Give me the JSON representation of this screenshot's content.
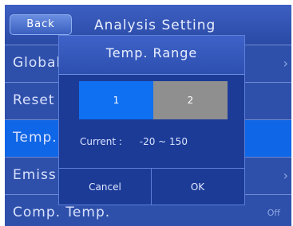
{
  "header": {
    "back_label": "Back",
    "title": "Analysis Setting"
  },
  "menu": {
    "items": [
      {
        "label": "Global",
        "value": ""
      },
      {
        "label": "Reset",
        "value": ""
      },
      {
        "label": "Temp.",
        "value": ""
      },
      {
        "label": "Emiss",
        "value": ""
      },
      {
        "label": "Comp. Temp.",
        "value": "Off"
      }
    ]
  },
  "dialog": {
    "title": "Temp. Range",
    "options": [
      "1",
      "2"
    ],
    "selected_option": "1",
    "current_label": "Current :",
    "current_value": "-20 ~ 150",
    "cancel_label": "Cancel",
    "ok_label": "OK"
  },
  "colors": {
    "accent": "#0f70f2",
    "background": "#1f3a86",
    "inactive_option": "#8f8f8f"
  }
}
